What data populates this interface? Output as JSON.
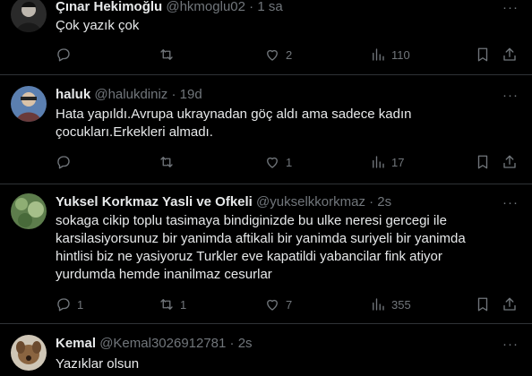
{
  "tweets": [
    {
      "name": "Çınar Hekimoğlu",
      "handle": "@hkmoglu02",
      "sep": "·",
      "time": "1 sa",
      "text": "Çok yazık çok",
      "replies": "",
      "retweets": "",
      "likes": "2",
      "views": "110",
      "avatar_color": "#3a3a3a"
    },
    {
      "name": "haluk",
      "handle": "@halukdiniz",
      "sep": "·",
      "time": "19d",
      "text": "Hata yapıldı.Avrupa ukraynadan göç aldı ama sadece kadın çocukları.Erkekleri almadı.",
      "replies": "",
      "retweets": "",
      "likes": "1",
      "views": "17",
      "avatar_color": "#4a6fa5"
    },
    {
      "name": "Yuksel Korkmaz Yasli ve Ofkeli",
      "handle": "@yukselkkorkmaz",
      "sep": "·",
      "time": "2s",
      "text": "sokaga cikip toplu tasimaya bindiginizde bu ulke neresi gercegi ile karsilasiyorsunuz bir yanimda aftikali bir yanimda suriyeli bir yanimda hintlisi biz ne yasiyoruz Turkler eve kapatildi yabancilar fink atiyor yurdumda hemde inanilmaz cesurlar",
      "replies": "1",
      "retweets": "1",
      "likes": "7",
      "views": "355",
      "avatar_color": "#6b8e5a"
    },
    {
      "name": "Kemal",
      "handle": "@Kemal3026912781",
      "sep": "·",
      "time": "2s",
      "text": "Yazıklar olsun",
      "avatar_color": "#8a6a4a"
    }
  ],
  "colors": {
    "background": "#000000",
    "text": "#e7e9ea",
    "muted": "#71767b",
    "divider": "#2f3336"
  },
  "icons": [
    "more-icon",
    "reply-icon",
    "retweet-icon",
    "like-icon",
    "views-icon",
    "bookmark-icon",
    "share-icon"
  ]
}
